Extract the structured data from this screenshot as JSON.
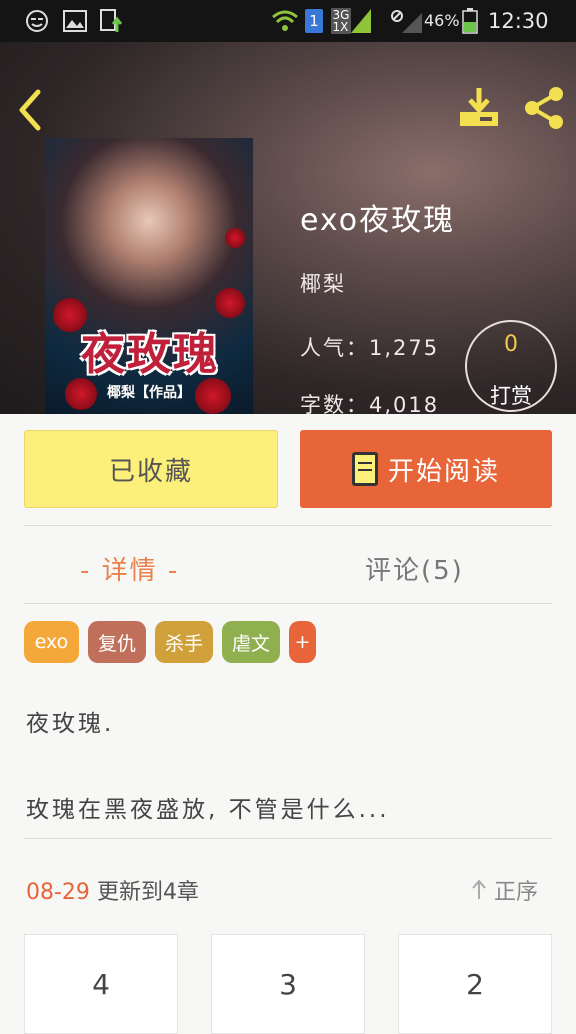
{
  "status_bar": {
    "battery": "46%",
    "time": "12:30",
    "network_top": "3G",
    "network_bottom": "1X",
    "sim": "1"
  },
  "book": {
    "title": "exo夜玫瑰",
    "author": "椰梨",
    "popularity_label": "人气：",
    "popularity": "1,275",
    "words_label": "字数：",
    "words": "4,018",
    "cover_title": "夜玫瑰",
    "cover_author": "椰梨【作品】",
    "reward_count": "0",
    "reward_label": "打赏"
  },
  "actions": {
    "favorite": "已收藏",
    "start_reading": "开始阅读"
  },
  "tabs": {
    "detail": "- 详情 -",
    "comments": "评论(5)"
  },
  "tags": [
    {
      "label": "exo",
      "color": "#f5a83a"
    },
    {
      "label": "复仇",
      "color": "#c0705a"
    },
    {
      "label": "杀手",
      "color": "#d0a03a"
    },
    {
      "label": "虐文",
      "color": "#90b050"
    },
    {
      "label": "+",
      "color": "#e8653a"
    }
  ],
  "description": {
    "line1": "夜玫瑰.",
    "line2": "玫瑰在黑夜盛放, 不管是什么..."
  },
  "update": {
    "date": "08-29",
    "text": "更新到4章",
    "sort_label": "正序"
  },
  "chapters": [
    "4",
    "3",
    "2"
  ],
  "colors": {
    "accent": "#e8653a",
    "favorite_bg": "#fcf07a",
    "tab_active": "#e8824a"
  }
}
